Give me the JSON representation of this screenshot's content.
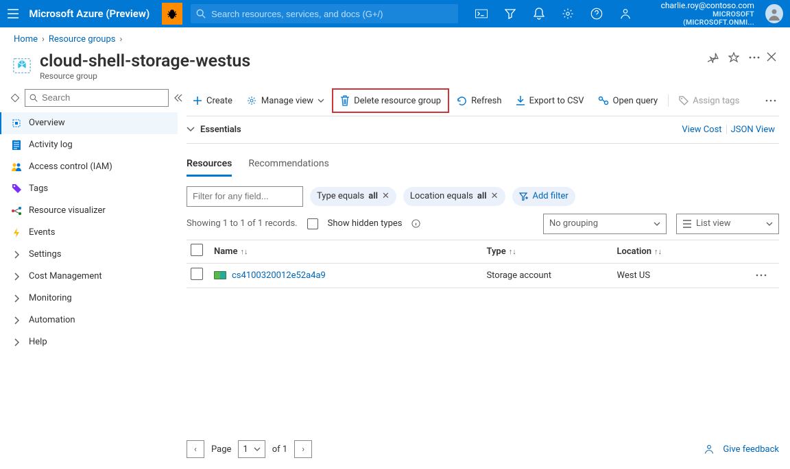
{
  "header": {
    "brand": "Microsoft Azure (Preview)",
    "search_placeholder": "Search resources, services, and docs (G+/)",
    "account_email": "charlie.roy@contoso.com",
    "account_tenant": "MICROSOFT (MICROSOFT.ONMI..."
  },
  "breadcrumb": {
    "items": [
      "Home",
      "Resource groups"
    ]
  },
  "blade": {
    "title": "cloud-shell-storage-westus",
    "subtitle": "Resource group"
  },
  "sidebar": {
    "search_placeholder": "Search",
    "items": [
      {
        "label": "Overview",
        "icon": "overview",
        "selected": true,
        "chevron": false
      },
      {
        "label": "Activity log",
        "icon": "activity",
        "selected": false,
        "chevron": false
      },
      {
        "label": "Access control (IAM)",
        "icon": "iam",
        "selected": false,
        "chevron": false
      },
      {
        "label": "Tags",
        "icon": "tags",
        "selected": false,
        "chevron": false
      },
      {
        "label": "Resource visualizer",
        "icon": "visualizer",
        "selected": false,
        "chevron": false
      },
      {
        "label": "Events",
        "icon": "events",
        "selected": false,
        "chevron": false
      },
      {
        "label": "Settings",
        "icon": "chevron",
        "selected": false,
        "chevron": true
      },
      {
        "label": "Cost Management",
        "icon": "chevron",
        "selected": false,
        "chevron": true
      },
      {
        "label": "Monitoring",
        "icon": "chevron",
        "selected": false,
        "chevron": true
      },
      {
        "label": "Automation",
        "icon": "chevron",
        "selected": false,
        "chevron": true
      },
      {
        "label": "Help",
        "icon": "chevron",
        "selected": false,
        "chevron": true
      }
    ]
  },
  "commands": {
    "create": "Create",
    "manage_view": "Manage view",
    "delete_rg": "Delete resource group",
    "refresh": "Refresh",
    "export_csv": "Export to CSV",
    "open_query": "Open query",
    "assign_tags": "Assign tags"
  },
  "essentials": {
    "label": "Essentials",
    "view_cost": "View Cost",
    "json_view": "JSON View"
  },
  "tabs": {
    "resources": "Resources",
    "recommendations": "Recommendations"
  },
  "filters": {
    "filter_placeholder": "Filter for any field...",
    "type_prefix": "Type equals ",
    "type_value": "all",
    "location_prefix": "Location equals ",
    "location_value": "all",
    "add_filter": "Add filter"
  },
  "list_meta": {
    "record_summary": "Showing 1 to 1 of 1 records.",
    "show_hidden": "Show hidden types",
    "grouping_value": "No grouping",
    "view_value": "List view"
  },
  "table": {
    "col_name": "Name",
    "col_type": "Type",
    "col_location": "Location",
    "rows": [
      {
        "name": "cs4100320012e52a4a9",
        "type": "Storage account",
        "location": "West US"
      }
    ]
  },
  "pager": {
    "page_label": "Page",
    "page_value": "1",
    "of_label": "of 1"
  },
  "feedback": {
    "label": "Give feedback"
  }
}
